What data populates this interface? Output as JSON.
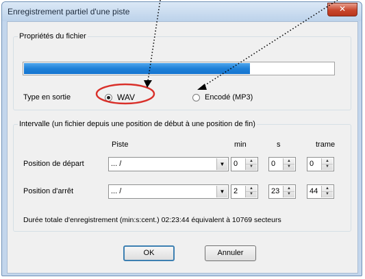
{
  "window": {
    "title": "Enregistrement partiel d'une piste",
    "close_label": "✕"
  },
  "file_group": {
    "legend": "Propriétés du fichier",
    "progress_fraction": 0.73,
    "output_type_label": "Type en sortie",
    "options": [
      {
        "label": "WAV",
        "selected": true
      },
      {
        "label": "Encodé (MP3)",
        "selected": false
      }
    ]
  },
  "interval_group": {
    "legend": "Intervalle (un fichier depuis une position de début à une position de fin)",
    "headers": {
      "track": "Piste",
      "min": "min",
      "sec": "s",
      "frame": "trame"
    },
    "start": {
      "label": "Position de départ",
      "track": "... /",
      "min": "0",
      "sec": "0",
      "frame": "0"
    },
    "stop": {
      "label": "Position d'arrêt",
      "track": "... /",
      "min": "2",
      "sec": "23",
      "frame": "44"
    },
    "summary": "Durée totale d'enregistrement (min:s:cent.) 02:23:44 équivalent à 10769 secteurs"
  },
  "buttons": {
    "ok": "OK",
    "cancel": "Annuler"
  },
  "colors": {
    "annotation_circle": "#d9302a",
    "progress": "#1f81d8"
  }
}
